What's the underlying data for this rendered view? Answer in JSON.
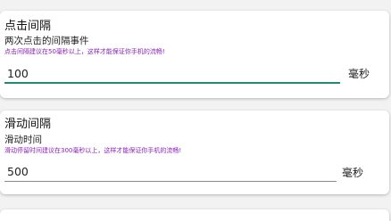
{
  "click_interval": {
    "title": "点击间隔",
    "subtitle": "两次点击的间隔事件",
    "hint": "点击间隔建议在50毫秒以上，这样才能保证你手机的流畅!",
    "value": "100",
    "unit": "毫秒"
  },
  "swipe_interval": {
    "title": "滑动间隔",
    "subtitle": "滑动时间",
    "hint": "滑动停留时间建议在300毫秒以上，这样才能保证你手机的流畅!",
    "value": "500",
    "unit": "毫秒"
  },
  "colors": {
    "hint": "#8a1fb8",
    "focused_underline": "#1d8a7c"
  }
}
